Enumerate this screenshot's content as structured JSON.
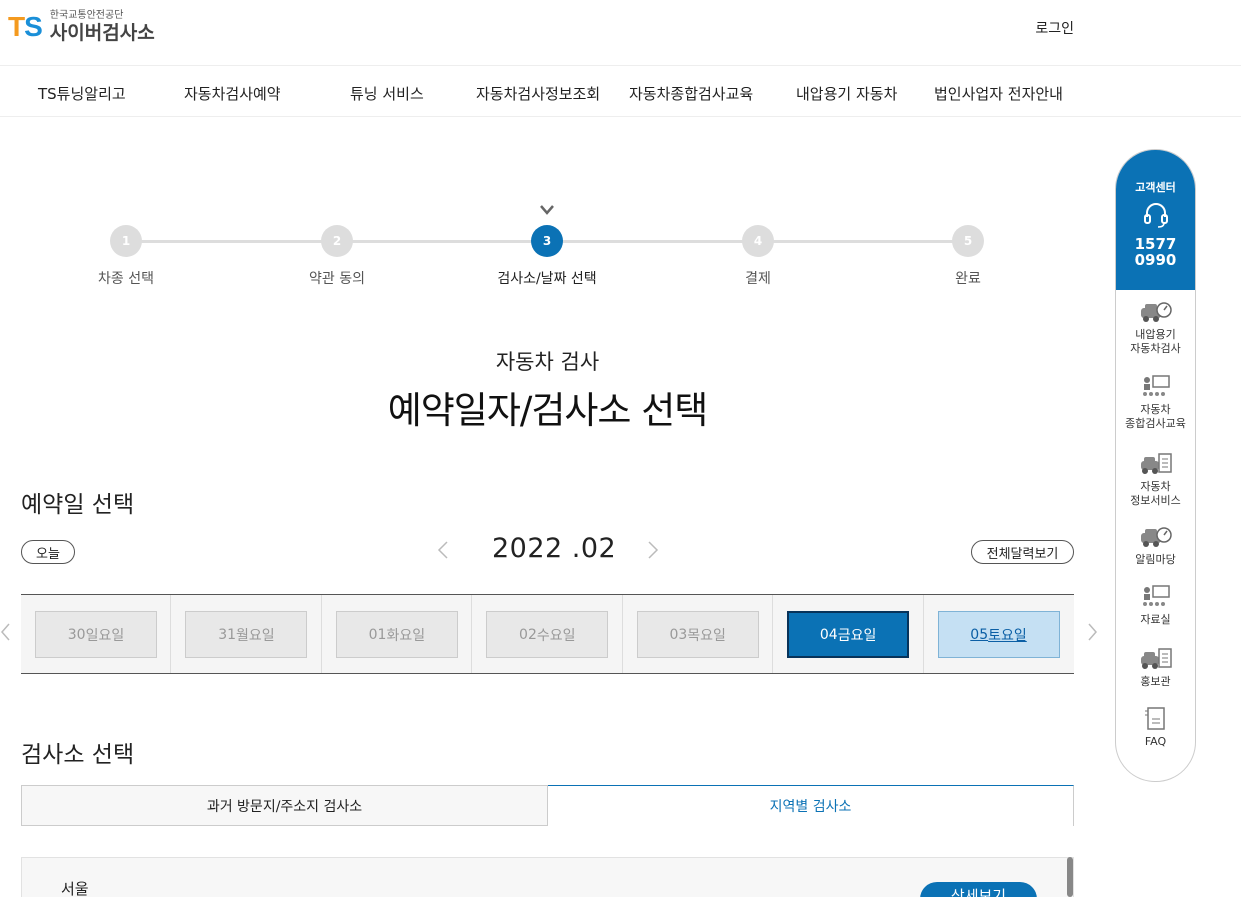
{
  "header": {
    "logo_mark": "TS",
    "logo_org": "한국교통안전공단",
    "logo_name": "사이버검사소",
    "login_label": "로그인"
  },
  "nav": {
    "items": [
      "TS튜닝알리고",
      "자동차검사예약",
      "튜닝 서비스",
      "자동차검사정보조회",
      "자동차종합검사교육",
      "내압용기 자동차",
      "법인사업자 전자안내"
    ]
  },
  "stepper": {
    "steps": [
      {
        "num": "1",
        "label": "차종 선택"
      },
      {
        "num": "2",
        "label": "약관 동의"
      },
      {
        "num": "3",
        "label": "검사소/날짜 선택"
      },
      {
        "num": "4",
        "label": "결제"
      },
      {
        "num": "5",
        "label": "완료"
      }
    ],
    "current": 3
  },
  "page": {
    "subtitle": "자동차 검사",
    "title": "예약일자/검사소 선택"
  },
  "date_section": {
    "heading": "예약일 선택",
    "today_label": "오늘",
    "month": "2022 .02",
    "calendar_label": "전체달력보기",
    "dates": [
      {
        "day": "30",
        "weekday": "일요일",
        "state": "disabled"
      },
      {
        "day": "31",
        "weekday": "월요일",
        "state": "disabled"
      },
      {
        "day": "01",
        "weekday": "화요일",
        "state": "disabled"
      },
      {
        "day": "02",
        "weekday": "수요일",
        "state": "disabled"
      },
      {
        "day": "03",
        "weekday": "목요일",
        "state": "disabled"
      },
      {
        "day": "04",
        "weekday": "금요일",
        "state": "selected"
      },
      {
        "day": "05",
        "weekday": "토요일",
        "state": "hover"
      }
    ]
  },
  "station_section": {
    "heading": "검사소 선택",
    "tabs": [
      {
        "label": "과거 방문지/주소지 검사소",
        "active": false
      },
      {
        "label": "지역별 검사소",
        "active": true
      }
    ],
    "region": "서울",
    "detail_label": "상세보기"
  },
  "quick_menu": {
    "title": "고객센터",
    "phone_line1": "1577",
    "phone_line2": "0990",
    "items": [
      {
        "line1": "내압용기",
        "line2": "자동차검사",
        "icon": "car-gauge-icon"
      },
      {
        "line1": "자동차",
        "line2": "종합검사교육",
        "icon": "education-icon"
      },
      {
        "line1": "자동차",
        "line2": "정보서비스",
        "icon": "car-info-icon"
      },
      {
        "line1": "알림마당",
        "line2": "",
        "icon": "car-gauge-icon"
      },
      {
        "line1": "자료실",
        "line2": "",
        "icon": "education-icon"
      },
      {
        "line1": "홍보관",
        "line2": "",
        "icon": "car-info-icon"
      },
      {
        "line1": "FAQ",
        "line2": "",
        "icon": "document-icon"
      }
    ]
  },
  "colors": {
    "primary": "#0b72b5",
    "logo_orange": "#f49a1f",
    "logo_blue": "#1a8fd8",
    "step_inactive": "#dddddd"
  }
}
